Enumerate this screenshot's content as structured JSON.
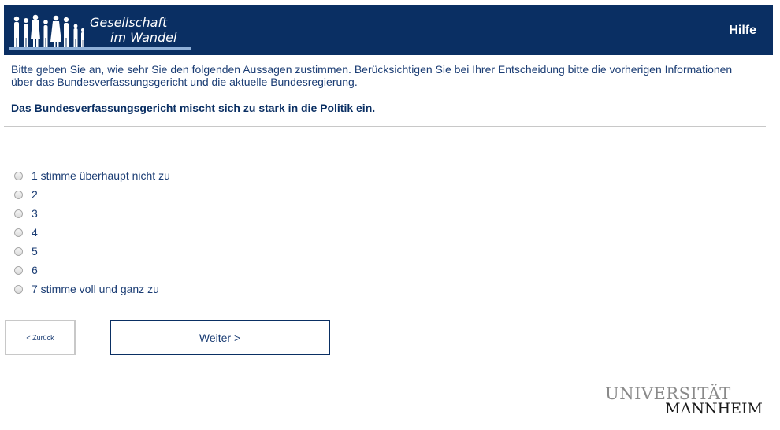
{
  "header": {
    "logo_line1": "Gesellschaft",
    "logo_line2": "im Wandel",
    "help_label": "Hilfe",
    "background_color": "#0a2f63"
  },
  "survey": {
    "intro": "Bitte geben Sie an, wie sehr Sie den folgenden Aussagen zustimmen. Berücksichtigen Sie bei Ihrer Entscheidung bitte die vorherigen Informationen über das Bundesverfassungsgericht und die aktuelle Bundesregierung.",
    "question": "Das Bundesverfassungsgericht mischt sich zu stark in die Politik ein.",
    "options": [
      {
        "label": "1 stimme überhaupt nicht zu"
      },
      {
        "label": "2"
      },
      {
        "label": "3"
      },
      {
        "label": "4"
      },
      {
        "label": "5"
      },
      {
        "label": "6"
      },
      {
        "label": "7 stimme voll und ganz zu"
      }
    ]
  },
  "navigation": {
    "back_label": "< Zurück",
    "next_label": "Weiter >"
  },
  "footer": {
    "logo_line1": "UNIVERSITÄT",
    "logo_line2": "MANNHEIM"
  }
}
